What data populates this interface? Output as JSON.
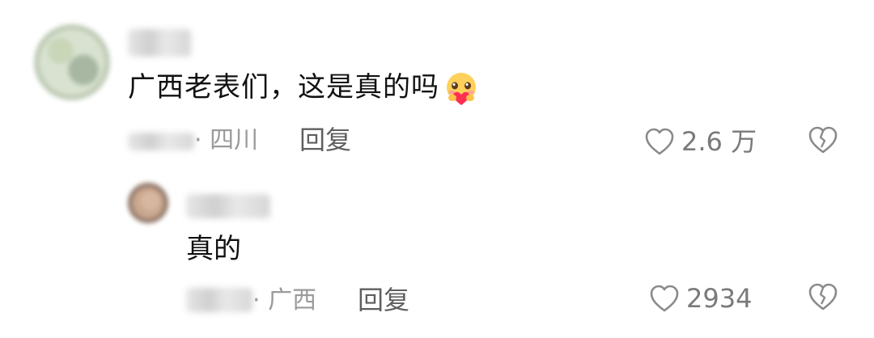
{
  "comment": {
    "text": "广西老表们，这是真的吗",
    "location": "· 四川",
    "reply_label": "回复",
    "like_count": "2.6 万",
    "icons": {
      "emoji": "heart-hug-emoji",
      "like": "heart-outline-icon",
      "dislike": "broken-heart-icon"
    }
  },
  "reply": {
    "text": "真的",
    "location": "· 广西",
    "reply_label": "回复",
    "like_count": "2934",
    "icons": {
      "like": "heart-outline-icon",
      "dislike": "broken-heart-icon"
    }
  },
  "colors": {
    "text": "#111111",
    "meta": "#9a9a9a",
    "icon": "#8a8a8a"
  }
}
